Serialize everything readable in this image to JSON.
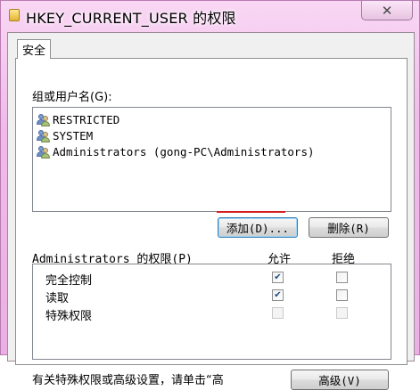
{
  "window": {
    "title": "HKEY_CURRENT_USER 的权限",
    "close_glyph": "✕"
  },
  "tabs": [
    {
      "label": "安全"
    }
  ],
  "groups": {
    "label": "组或用户名(G):",
    "items": [
      {
        "name": "RESTRICTED"
      },
      {
        "name": "SYSTEM"
      },
      {
        "name": "Administrators (gong-PC\\Administrators)"
      }
    ],
    "add_button": "添加(D)...",
    "remove_button": "删除(R)"
  },
  "permissions": {
    "header": "Administrators 的权限(P)",
    "allow_header": "允许",
    "deny_header": "拒绝",
    "rows": [
      {
        "name": "完全控制",
        "allow": true,
        "deny": false,
        "enabled": true
      },
      {
        "name": "读取",
        "allow": true,
        "deny": false,
        "enabled": true
      },
      {
        "name": "特殊权限",
        "allow": false,
        "deny": false,
        "enabled": false
      }
    ]
  },
  "footer": {
    "text": "有关特殊权限或高级设置，请单击“高",
    "advanced_button": "高级(V)"
  },
  "colors": {
    "title_bar": "#f0bbe9",
    "highlight_underline": "#d31f1f",
    "check_mark": "#1b4a8a"
  },
  "icons": {
    "title": "folder-icon",
    "close": "close-icon",
    "user": "user-group-icon",
    "check": "checkmark-icon"
  }
}
